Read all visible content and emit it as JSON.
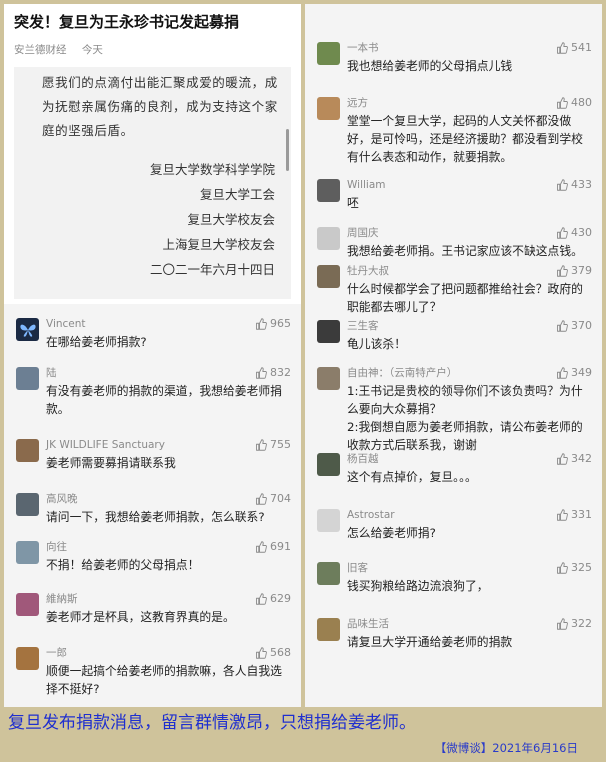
{
  "article": {
    "title": "突发！复旦为王永珍书记发起募捐",
    "source": "安兰德财经",
    "time": "今天",
    "paragraph": "愿我们的点滴付出能汇聚成爱的暖流，成为抚慰亲属伤痛的良剂，成为支持这个家庭的坚强后盾。",
    "signatures": [
      "复旦大学数学科学学院",
      "复旦大学工会",
      "复旦大学校友会",
      "上海复旦大学校友会",
      "二〇二一年六月十四日"
    ]
  },
  "comments_left": [
    {
      "user": "Vincent",
      "likes": "965",
      "text": "在哪给姜老师捐款?",
      "avatar_color": "#1b2a44",
      "avatar_icon": "butterfly-icon"
    },
    {
      "user": "陆",
      "likes": "832",
      "text": "有没有姜老师的捐款的渠道，我想给姜老师捐款。",
      "avatar_color": "#6c7f93",
      "avatar_icon": "photo-avatar"
    },
    {
      "user": "JK WILDLIFE Sanctuary",
      "likes": "755",
      "text": "姜老师需要募捐请联系我",
      "avatar_color": "#8a6a4c",
      "avatar_icon": "photo-avatar"
    },
    {
      "user": "高风晚",
      "likes": "704",
      "text": "请问一下，我想给姜老师捐款，怎么联系?",
      "avatar_color": "#5a6670",
      "avatar_icon": "photo-avatar"
    },
    {
      "user": "向往",
      "likes": "691",
      "text": "不捐！给姜老师的父母捐点！",
      "avatar_color": "#7f96a6",
      "avatar_icon": "photo-avatar"
    },
    {
      "user": "維納斯",
      "likes": "629",
      "text": "姜老师才是杯具，这教育界真的是。",
      "avatar_color": "#a0587a",
      "avatar_icon": "photo-avatar"
    },
    {
      "user": "一郎",
      "likes": "568",
      "text": "顺便一起搞个给姜老师的捐款嘛，各人自我选择不挺好?",
      "avatar_color": "#a4733f",
      "avatar_icon": "photo-avatar"
    }
  ],
  "comments_right": [
    {
      "user": "一本书",
      "likes": "541",
      "text": "我也想给姜老师的父母捐点儿钱",
      "avatar_color": "#6f8a4e",
      "avatar_icon": "photo-avatar"
    },
    {
      "user": "远方",
      "likes": "480",
      "text": "堂堂一个复旦大学，起码的人文关怀都没做好，是可怜吗，还是经济援助？都没看到学校有什么表态和动作，就要捐款。",
      "avatar_color": "#b88a5a",
      "avatar_icon": "photo-avatar"
    },
    {
      "user": "William",
      "likes": "433",
      "text": "呸",
      "avatar_color": "#5e5e5e",
      "avatar_icon": "photo-avatar"
    },
    {
      "user": "周国庆",
      "likes": "430",
      "text": "我想给姜老师捐。王书记家应该不缺这点钱。",
      "avatar_color": "#c9c9c9",
      "avatar_icon": "photo-avatar"
    },
    {
      "user": "牡丹大叔",
      "likes": "379",
      "text": "什么时候都学会了把问题都推给社会？政府的职能都去哪儿了？",
      "avatar_color": "#7a6b55",
      "avatar_icon": "photo-avatar"
    },
    {
      "user": "三生客",
      "likes": "370",
      "text": "龟儿该杀！",
      "avatar_color": "#3b3b3b",
      "avatar_icon": "photo-avatar"
    },
    {
      "user": "自由神：（云南特产户）",
      "likes": "349",
      "text": "1:王书记是贵校的领导你们不该负责吗？为什么要向大众募捐？\n2:我倒想自愿为姜老师捐款，请公布姜老师的收款方式后联系我，谢谢",
      "avatar_color": "#8b7d6a",
      "avatar_icon": "photo-avatar"
    },
    {
      "user": "杨百越",
      "likes": "342",
      "text": "这个有点掉价，复旦。。。",
      "avatar_color": "#4e5a49",
      "avatar_icon": "photo-avatar"
    },
    {
      "user": "Astrostar",
      "likes": "331",
      "text": "怎么给姜老师捐?",
      "avatar_color": "#d4d4d4",
      "avatar_icon": "photo-avatar"
    },
    {
      "user": "旧客",
      "likes": "325",
      "text": "钱买狗粮给路边流浪狗了，",
      "avatar_color": "#6d7d5c",
      "avatar_icon": "photo-avatar"
    },
    {
      "user": "品味生活",
      "likes": "322",
      "text": "请复旦大学开通给姜老师的捐款",
      "avatar_color": "#9a8050",
      "avatar_icon": "photo-avatar"
    }
  ],
  "caption": {
    "main": "复旦发布捐款消息，留言群情激昂，只想捐给姜老师。",
    "source": "【微博谈】2021年6月16日"
  }
}
